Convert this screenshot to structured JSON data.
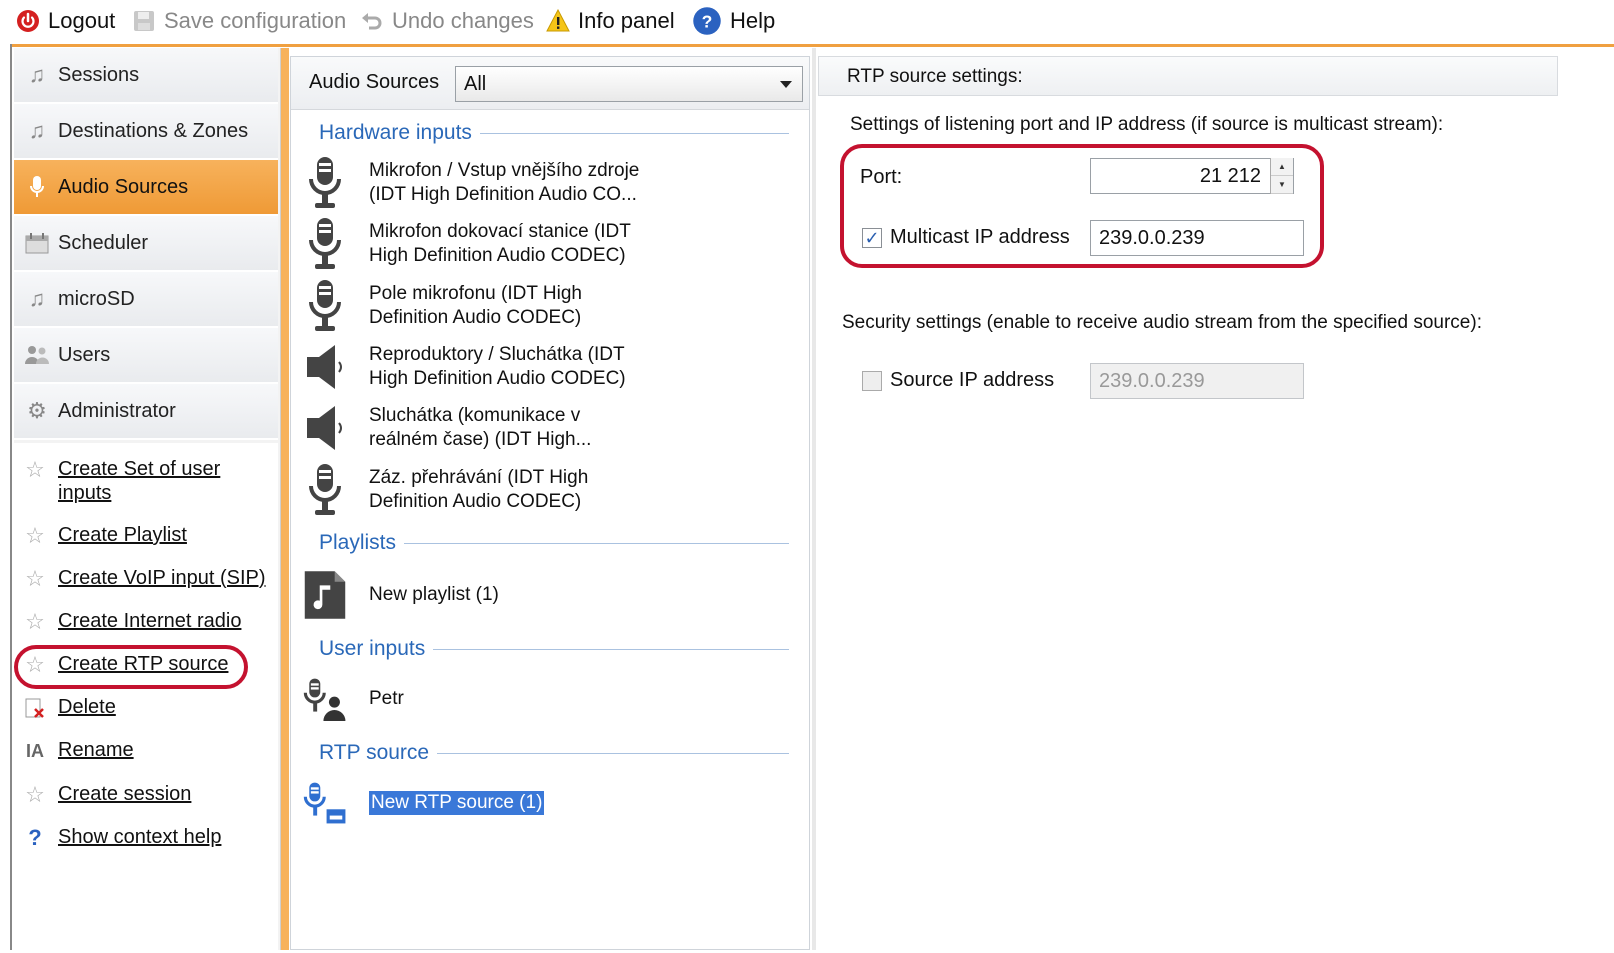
{
  "toolbar": {
    "logout": "Logout",
    "save": "Save configuration",
    "undo": "Undo changes",
    "info": "Info panel",
    "help": "Help"
  },
  "nav": {
    "items": [
      {
        "label": "Sessions",
        "icon": "music-note-icon"
      },
      {
        "label": "Destinations & Zones",
        "icon": "music-note-icon"
      },
      {
        "label": "Audio Sources",
        "icon": "microphone-icon"
      },
      {
        "label": "Scheduler",
        "icon": "calendar-icon"
      },
      {
        "label": "microSD",
        "icon": "music-note-icon"
      },
      {
        "label": "Users",
        "icon": "users-icon"
      },
      {
        "label": "Administrator",
        "icon": "gear-icon"
      }
    ],
    "actions": [
      {
        "label": "Create Set of user inputs",
        "icon": "star-icon"
      },
      {
        "label": "Create Playlist",
        "icon": "star-icon"
      },
      {
        "label": "Create VoIP input (SIP)",
        "icon": "star-icon"
      },
      {
        "label": "Create Internet radio",
        "icon": "star-icon"
      },
      {
        "label": "Create RTP source",
        "icon": "star-icon"
      },
      {
        "label": "Delete",
        "icon": "delete-icon"
      },
      {
        "label": "Rename",
        "icon": "rename-icon"
      },
      {
        "label": "Create session",
        "icon": "star-icon"
      },
      {
        "label": "Show context help",
        "icon": "question-icon"
      }
    ]
  },
  "audio_sources": {
    "label": "Audio Sources",
    "filter_value": "All",
    "sections": {
      "hardware": "Hardware inputs",
      "playlists": "Playlists",
      "user_inputs": "User inputs",
      "rtp": "RTP source"
    },
    "hardware_items": [
      {
        "line1": "Mikrofon / Vstup vnějšího zdroje",
        "line2": "(IDT High Definition Audio CO..."
      },
      {
        "line1": "Mikrofon dokovací stanice (IDT",
        "line2": "High Definition Audio CODEC)"
      },
      {
        "line1": "Pole mikrofonu (IDT High",
        "line2": "Definition Audio CODEC)"
      },
      {
        "line1": "Reproduktory / Sluchátka (IDT",
        "line2": "High Definition Audio CODEC)"
      },
      {
        "line1": "Sluchátka (komunikace v",
        "line2": "reálném čase) (IDT High..."
      },
      {
        "line1": "Záz. přehrávání (IDT High",
        "line2": "Definition Audio CODEC)"
      }
    ],
    "playlist_items": [
      "New playlist (1)"
    ],
    "user_input_items": [
      "Petr"
    ],
    "rtp_items": [
      "New RTP source (1)"
    ]
  },
  "rtp_settings": {
    "title": "RTP source settings:",
    "listening_desc": "Settings of listening port and IP address (if source is multicast stream):",
    "port_label": "Port:",
    "port_value": "21 212",
    "multicast_label": "Multicast IP address",
    "multicast_checked": true,
    "multicast_value": "239.0.0.239",
    "security_desc": "Security settings (enable to receive audio stream from the specified source):",
    "source_ip_label": "Source IP address",
    "source_ip_checked": false,
    "source_ip_value": "239.0.0.239"
  },
  "colors": {
    "accent": "#ef9a36",
    "highlight": "#c4122f",
    "section": "#2a68b8",
    "selection": "#3a78d8"
  }
}
